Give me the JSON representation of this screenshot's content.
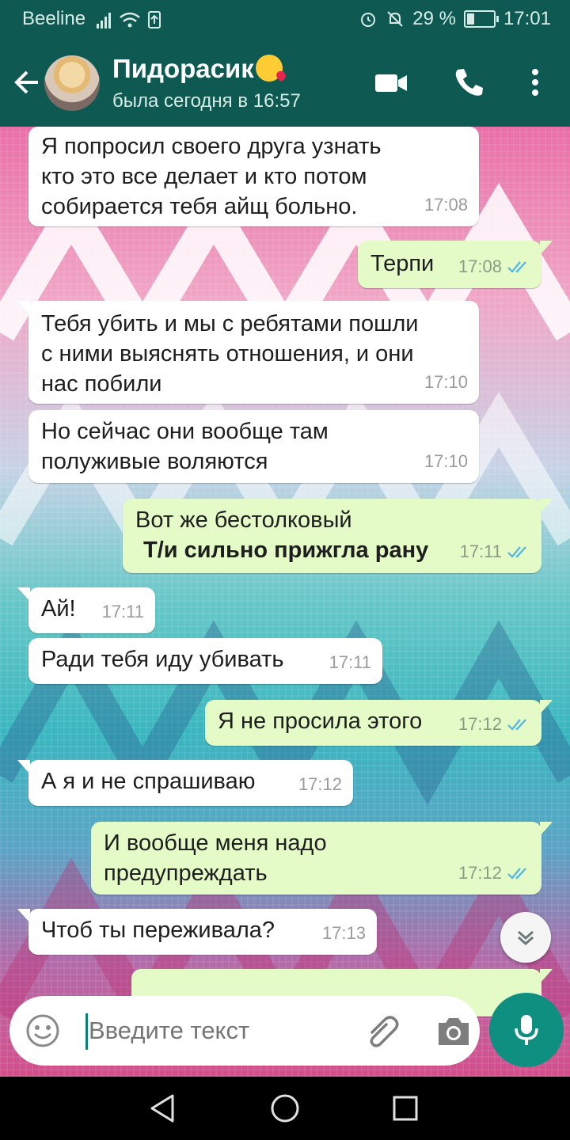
{
  "status_bar": {
    "carrier": "Beeline",
    "battery": "29 %",
    "battery_level": 0.29,
    "time": "17:01"
  },
  "header": {
    "contact_name": "Пидорасик",
    "contact_status": "была сегодня в 16:57",
    "emoji": "face-throwing-kiss-emoji"
  },
  "messages": [
    {
      "dir": "in",
      "text": "Я попросил своего друга узнать\nкто это все делает и кто потом\nсобирается тебя айщ больно.",
      "time": "17:08"
    },
    {
      "dir": "out",
      "text": "Терпи",
      "time": "17:08",
      "read": true
    },
    {
      "dir": "in",
      "text": "Тебя убить и мы с ребятами пошли\nс ними выяснять отношения, и они\nнас побили",
      "time": "17:10"
    },
    {
      "dir": "in",
      "text": "Но сейчас они вообще там\nполуживые воляются",
      "time": "17:10"
    },
    {
      "dir": "out",
      "text": "Вот же бестолковый",
      "text_bold": "Т/и сильно прижгла рану",
      "time": "17:11",
      "read": true
    },
    {
      "dir": "in",
      "text": "Ай!",
      "time": "17:11"
    },
    {
      "dir": "in",
      "text": "Ради тебя иду убивать",
      "time": "17:11"
    },
    {
      "dir": "out",
      "text": "Я не просила этого",
      "time": "17:12",
      "read": true
    },
    {
      "dir": "in",
      "text": "А я и не спрашиваю",
      "time": "17:12"
    },
    {
      "dir": "out",
      "text": "И вообще меня надо\nпредупреждать",
      "time": "17:12",
      "read": true
    },
    {
      "dir": "in",
      "text": "Чтоб ты переживала?",
      "time": "17:13"
    }
  ],
  "input": {
    "placeholder": "Введите текст"
  },
  "colors": {
    "header": "#0e5a52",
    "accent": "#0f8f80",
    "out_bubble": "#e4fbc8",
    "in_bubble": "#ffffff",
    "read_ticks": "#4fb6ec"
  }
}
